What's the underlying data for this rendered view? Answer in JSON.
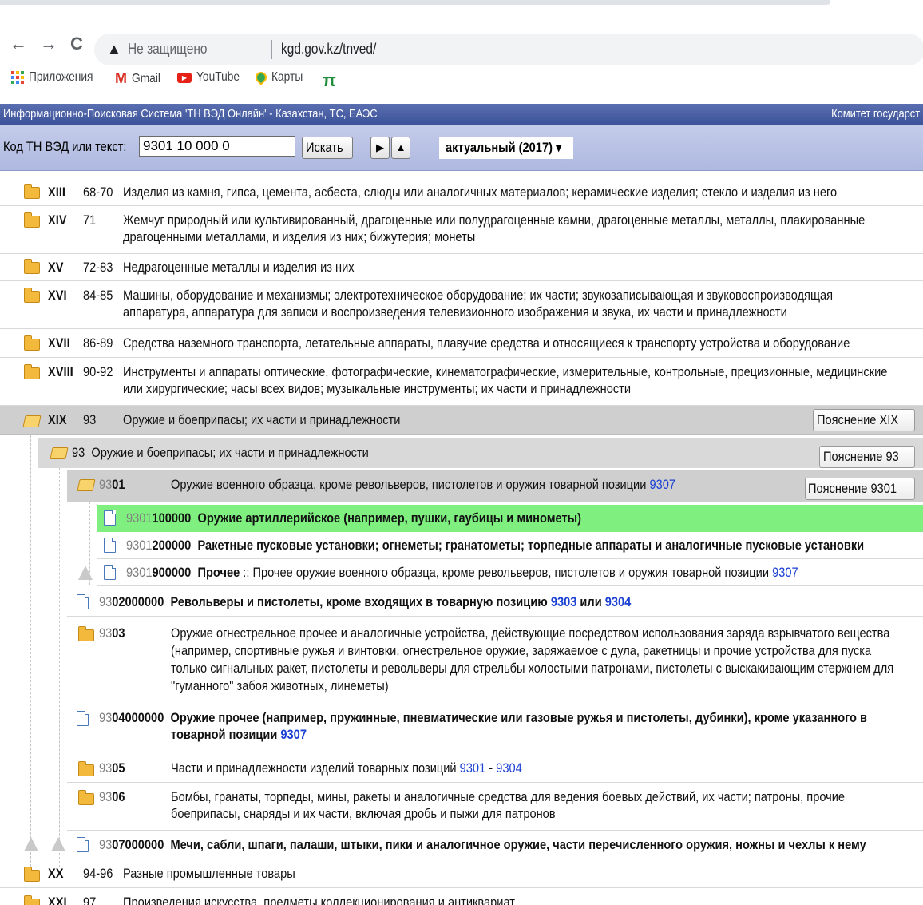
{
  "browser": {
    "back": "←",
    "forward": "→",
    "reload": "C",
    "not_secure": "Не защищено",
    "url": "kgd.gov.kz/tnved/",
    "bookmarks": [
      "Приложения",
      "Gmail",
      "YouTube",
      "Карты",
      "π"
    ]
  },
  "site": {
    "title": "Информационно-Поисковая Система 'ТН ВЭД Онлайн' - Казахстан, ТС, ЕАЭС",
    "right_title": "Комитет государст",
    "search_label": "Код ТН ВЭД или текст:",
    "search_value": "9301 10 000 0",
    "search_button": "Искать",
    "next_button": "▶",
    "up_button": "▲",
    "version": "актуальный (2017) ▾"
  },
  "sections": [
    {
      "code": "XIII",
      "range": "68-70",
      "text": "Изделия из камня, гипса, цемента, асбеста, слюды или аналогичных материалов; керамические изделия; стекло и изделия из него"
    },
    {
      "code": "XIV",
      "range": "71",
      "text": "Жемчуг природный или культивированный, драгоценные или полудрагоценные камни, драгоценные металлы, металлы, плакированные",
      "text2": "драгоценными металлами, и изделия из них; бижутерия; монеты"
    },
    {
      "code": "XV",
      "range": "72-83",
      "text": "Недрагоценные металлы и изделия из них"
    },
    {
      "code": "XVI",
      "range": "84-85",
      "text": "Машины, оборудование и механизмы; электротехническое оборудование; их части; звукозаписывающая и звуковоспроизводящая",
      "text2": "аппаратура, аппаратура для записи и воспроизведения телевизионного изображения и звука, их части и принадлежности"
    },
    {
      "code": "XVII",
      "range": "86-89",
      "text": "Средства наземного транспорта, летательные аппараты, плавучие средства и относящиеся к транспорту устройства и оборудование"
    },
    {
      "code": "XVIII",
      "range": "90-92",
      "text": "Инструменты и аппараты оптические, фотографические, кинематографические, измерительные, контрольные, прецизионные, медицинские",
      "text2": "или хирургические; часы всех видов; музыкальные инструменты; их части и принадлежности"
    },
    {
      "code": "XIX",
      "range": "93",
      "text": "Оружие и боеприпасы; их части и принадлежности",
      "button": "Пояснение XIX"
    }
  ],
  "group93": {
    "code": "93",
    "text": "Оружие и боеприпасы; их части и принадлежности",
    "button": "Пояснение 93"
  },
  "heading9301": {
    "code_pre": "93",
    "code_post": "01",
    "text": "Оружие военного образца, кроме револьверов, пистолетов и оружия товарной позиции ",
    "link": "9307",
    "button": "Пояснение 9301"
  },
  "items9301": [
    {
      "pre": "9301",
      "post": "100000",
      "text": "Оружие артиллерийское (например, пушки, гаубицы и минометы)"
    },
    {
      "pre": "9301",
      "post": "200000",
      "text": "Ракетные пусковые установки; огнеметы; гранатометы; торпедные аппараты и аналогичные пусковые установки"
    },
    {
      "pre": "9301",
      "post": "900000",
      "text": "Прочее",
      "text_tail": " :: Прочее оружие военного образца, кроме револьверов, пистолетов и оружия товарной позиции ",
      "link": "9307"
    }
  ],
  "item9302": {
    "pre": "93",
    "post": "02000000",
    "text": "Револьверы и пистолеты, кроме входящих в товарную позицию ",
    "link1": "9303",
    "mid": " или ",
    "link2": "9304"
  },
  "heading9303": {
    "pre": "93",
    "post": "03",
    "lines": [
      "Оружие огнестрельное прочее и аналогичные устройства, действующие посредством использования заряда взрывчатого вещества",
      "(например, спортивные ружья и винтовки, огнестрельное оружие, заряжаемое с дула, ракетницы и прочие устройства для пуска",
      "только сигнальных ракет, пистолеты и револьверы для стрельбы холостыми патронами, пистолеты с выскакивающим стержнем для",
      "\"гуманного\" забоя животных, линеметы)"
    ]
  },
  "item9304": {
    "pre": "93",
    "post": "04000000",
    "text": "Оружие прочее (например, пружинные, пневматические или газовые ружья и пистолеты, дубинки), кроме указанного в",
    "text2": "товарной позиции ",
    "link": "9307"
  },
  "heading9305": {
    "pre": "93",
    "post": "05",
    "text": "Части и принадлежности изделий товарных позиций ",
    "link1": "9301",
    "mid": " - ",
    "link2": "9304"
  },
  "heading9306": {
    "pre": "93",
    "post": "06",
    "text": "Бомбы, гранаты, торпеды, мины, ракеты и аналогичные средства для ведения боевых действий, их части; патроны, прочие",
    "text2": "боеприпасы, снаряды и их части, включая дробь и пыжи для патронов"
  },
  "item9307": {
    "pre": "93",
    "post": "07000000",
    "text": "Мечи, сабли, шпаги, палаши, штыки, пики и аналогичное оружие, части перечисленного оружия, ножны и чехлы к нему"
  },
  "sections_tail": [
    {
      "code": "XX",
      "range": "94-96",
      "text": "Разные промышленные товары"
    },
    {
      "code": "XXI",
      "range": "97",
      "text": "Произведения искусства, предметы коллекционирования и антиквариат"
    }
  ],
  "colors": {
    "highlight": "#7ff07f",
    "expanded_row": "#cfcfcf",
    "link": "#1a3fd3",
    "header_bar": "#4a60a6"
  }
}
